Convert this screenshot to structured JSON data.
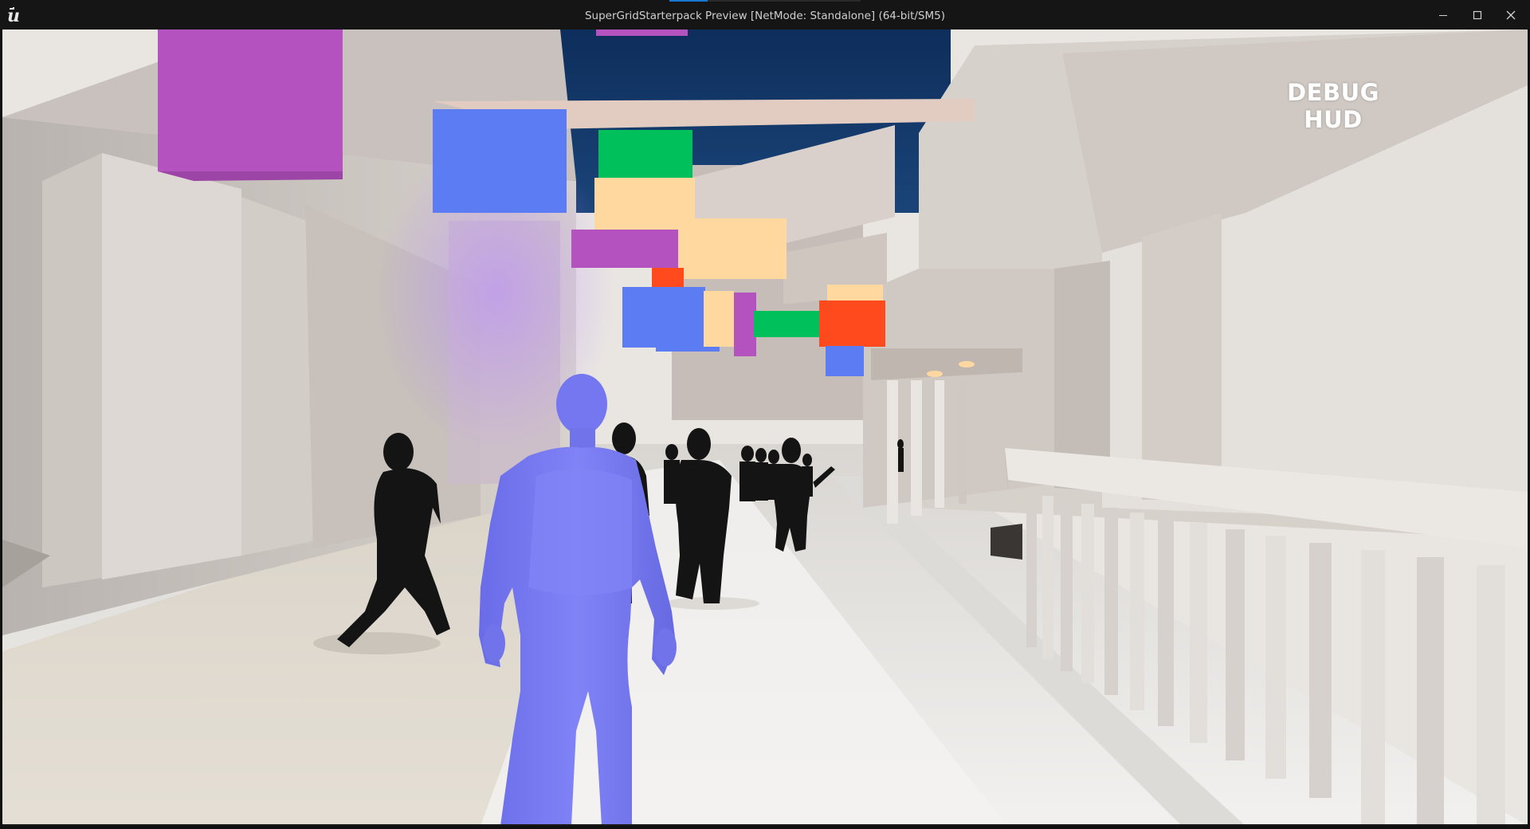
{
  "window": {
    "title": "SuperGridStarterpack Preview [NetMode: Standalone]  (64-bit/SM5)",
    "controls": {
      "minimize_icon": "minimize-icon",
      "maximize_icon": "maximize-icon",
      "close_icon": "close-icon"
    },
    "accent_color": "#1778d3"
  },
  "viewport": {
    "hud": {
      "label": "DEBUG HUD"
    },
    "player_color": "#7477f0",
    "sign_colors": {
      "magenta": "#b452bf",
      "blue": "#5b7cf2",
      "green": "#00c05c",
      "peach": "#ffd8a0",
      "orange": "#ff4a1e"
    }
  }
}
